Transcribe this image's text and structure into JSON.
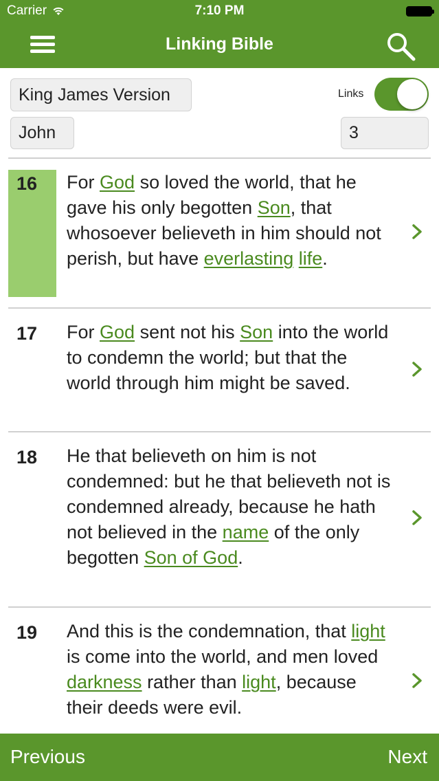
{
  "status_bar": {
    "carrier": "Carrier",
    "time": "7:10 PM"
  },
  "nav": {
    "title": "Linking Bible"
  },
  "controls": {
    "version": "King James Version",
    "links_label": "Links",
    "links_enabled": true,
    "book": "John",
    "chapter": "3"
  },
  "verses": [
    {
      "number": "16",
      "selected": true,
      "segments": [
        {
          "t": "For "
        },
        {
          "t": "God",
          "link": true
        },
        {
          "t": " so loved the world, that he gave his only begotten "
        },
        {
          "t": "Son",
          "link": true
        },
        {
          "t": ", that whosoever believeth in him should not perish, but have "
        },
        {
          "t": "everlasting",
          "link": true
        },
        {
          "t": " "
        },
        {
          "t": "life",
          "link": true
        },
        {
          "t": "."
        }
      ]
    },
    {
      "number": "17",
      "selected": false,
      "segments": [
        {
          "t": "For "
        },
        {
          "t": "God",
          "link": true
        },
        {
          "t": " sent not his "
        },
        {
          "t": "Son",
          "link": true
        },
        {
          "t": " into the world to condemn the world; but that the world through him might be saved."
        }
      ]
    },
    {
      "number": "18",
      "selected": false,
      "segments": [
        {
          "t": "He that believeth on him is not condemned: but he that believeth not is condemned already, because he hath not believed in the "
        },
        {
          "t": "name",
          "link": true
        },
        {
          "t": " of the only begotten "
        },
        {
          "t": "Son of God",
          "link": true
        },
        {
          "t": "."
        }
      ]
    },
    {
      "number": "19",
      "selected": false,
      "segments": [
        {
          "t": "And this is the condemnation, that "
        },
        {
          "t": "light",
          "link": true
        },
        {
          "t": " is come into the world, and men loved "
        },
        {
          "t": "darkness",
          "link": true
        },
        {
          "t": " rather than "
        },
        {
          "t": "light",
          "link": true
        },
        {
          "t": ", because their deeds were evil."
        }
      ]
    }
  ],
  "footer": {
    "previous": "Previous",
    "next": "Next"
  },
  "colors": {
    "brand_green": "#5a962c",
    "highlight_green": "#9acd6e",
    "link_green": "#4a8a1f"
  }
}
